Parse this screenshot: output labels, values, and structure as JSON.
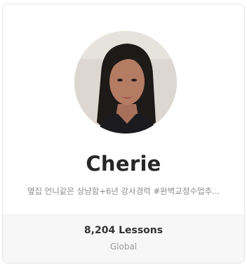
{
  "tutor": {
    "name": "Cherie",
    "tagline": "옆집 언니같은 상냥함+6년 강사경력 #완벽교정수업추...",
    "lessons": "8,204 Lessons",
    "region": "Global",
    "avatar_icon": "tutor-photo"
  }
}
